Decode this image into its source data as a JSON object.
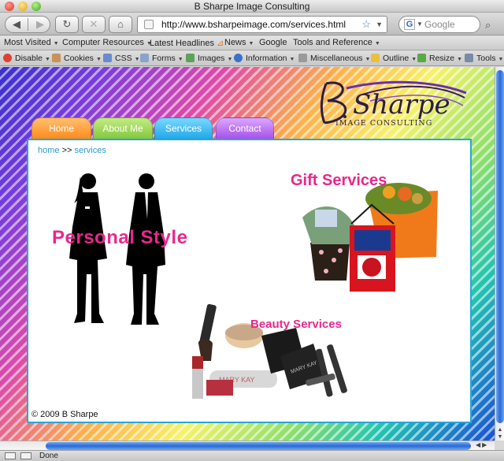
{
  "window": {
    "title": "B Sharpe Image Consulting"
  },
  "toolbar": {
    "back_glyph": "◀",
    "forward_glyph": "▶",
    "reload_glyph": "↻",
    "stop_glyph": "✕",
    "home_glyph": "⌂",
    "url": "http://www.bsharpeimage.com/services.html",
    "search_placeholder": "Google"
  },
  "bookmarks": [
    "Most Visited",
    "Computer Resources",
    "Latest Headlines",
    "News",
    "Google",
    "Tools and Reference"
  ],
  "devtools": [
    "Disable",
    "Cookies",
    "CSS",
    "Forms",
    "Images",
    "Information",
    "Miscellaneous",
    "Outline",
    "Resize",
    "Tools"
  ],
  "site": {
    "logo_text": "IMAGE CONSULTING",
    "tabs": [
      "Home",
      "About Me",
      "Services",
      "Contact"
    ],
    "breadcrumb": {
      "home": "home",
      "separator": ">>",
      "current": "services"
    },
    "sections": {
      "personal": "Personal Style",
      "gift": "Gift Services",
      "beauty": "Beauty Services"
    },
    "footer": "© 2009 B Sharpe"
  },
  "status": {
    "text": "Done"
  },
  "colors": {
    "accent_pink": "#e8288c",
    "panel_border": "#29a6d8",
    "scroll_blue": "#2a6ad8"
  }
}
